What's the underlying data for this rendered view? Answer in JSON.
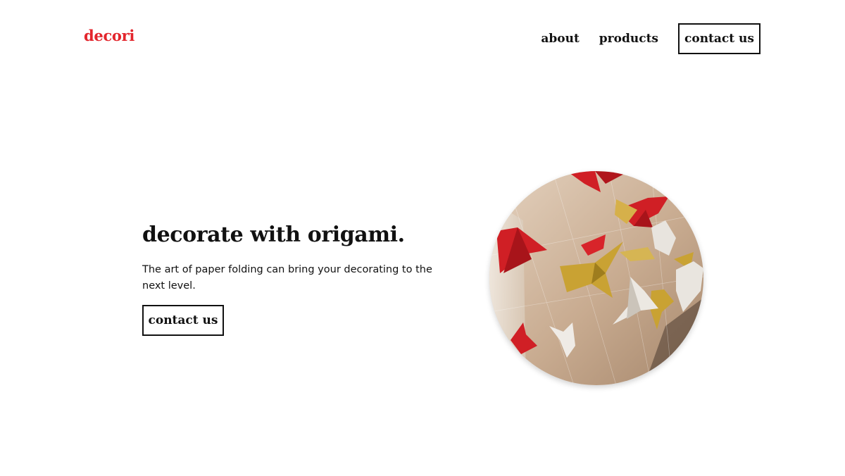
{
  "header": {
    "logo": "decori",
    "nav": {
      "about": "about",
      "products": "products",
      "contact": "contact us"
    }
  },
  "hero": {
    "title": "decorate with origami.",
    "text": "The art of paper folding can bring your decorating to the next level.",
    "button": "contact us",
    "image": {
      "subject": "origami paper cranes",
      "crane_colors": [
        "#d01f25",
        "#c9a233",
        "#e8e4de"
      ]
    }
  },
  "colors": {
    "brand": "#e3262d",
    "text": "#111111",
    "background": "#ffffff"
  }
}
